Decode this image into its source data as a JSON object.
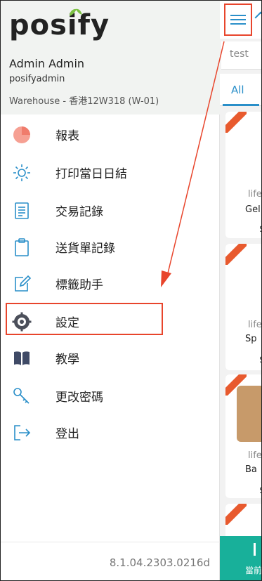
{
  "app": {
    "logo_text": "posify"
  },
  "user": {
    "name": "Admin Admin",
    "login": "posifyadmin",
    "warehouse": "Warehouse - 香港12W318 (W-01)"
  },
  "menu": {
    "items": [
      {
        "label": "報表",
        "icon": "pie-chart-icon"
      },
      {
        "label": "打印當日日結",
        "icon": "sun-icon"
      },
      {
        "label": "交易記錄",
        "icon": "document-list-icon"
      },
      {
        "label": "送貨單記錄",
        "icon": "clipboard-icon"
      },
      {
        "label": "標籤助手",
        "icon": "edit-note-icon"
      },
      {
        "label": "設定",
        "icon": "gear-icon"
      },
      {
        "label": "教學",
        "icon": "book-icon"
      },
      {
        "label": "更改密碼",
        "icon": "key-icon"
      },
      {
        "label": "登出",
        "icon": "logout-icon"
      }
    ]
  },
  "version": "8.1.04.2303.0216d",
  "page": {
    "search_value": "test",
    "tab_all": "All",
    "cards": [
      {
        "brand": "life",
        "name": "Gel I",
        "price": "$"
      },
      {
        "brand": "life",
        "name": "Sp",
        "price": "$"
      },
      {
        "brand": "life",
        "name": "Ba",
        "price": "$"
      }
    ],
    "bottom_label": "當前"
  },
  "colors": {
    "accent": "#2a8fc9",
    "highlight": "#e8452c",
    "badge": "#e85a2e",
    "bottom_bar": "#18b09a",
    "drawer_header": "#f1f3f1"
  }
}
